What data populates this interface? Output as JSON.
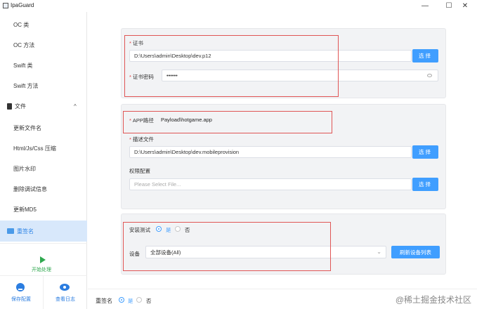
{
  "window": {
    "title": "IpaGuard",
    "min_glyph": "—",
    "max_glyph": "☐",
    "close_glyph": "✕"
  },
  "sidebar": {
    "items": [
      {
        "label": "OC 类"
      },
      {
        "label": "OC 方法"
      },
      {
        "label": "Swift 类"
      },
      {
        "label": "Swift 方法"
      }
    ],
    "section": {
      "label": "文件",
      "chevron": "^"
    },
    "file_items": [
      {
        "label": "更新文件名"
      },
      {
        "label": "Html/Js/Css 压缩"
      },
      {
        "label": "图片水印"
      },
      {
        "label": "删除调试信息"
      },
      {
        "label": "更新MD5"
      }
    ],
    "active_item": {
      "label": "重签名"
    },
    "run_label": "开始处理",
    "save_config": "保存配置",
    "view_log": "查看日志"
  },
  "cert_card": {
    "cert_label": "证书",
    "cert_path": "D:\\Users\\admin\\Desktop\\dev.p12",
    "cert_pwd_label": "证书密码",
    "cert_pwd_value": "••••••",
    "select_btn": "选择"
  },
  "profile_card": {
    "app_path_label": "APP路径",
    "app_path_value": "Payload\\hotgame.app",
    "desc_label": "描述文件",
    "desc_path": "D:\\Users\\admin\\Desktop\\dev.mobileprovision",
    "select_btn": "选择",
    "entitlements_label": "权限配置",
    "entitlements_placeholder": "Please Select File...",
    "select_btn2": "选择"
  },
  "install_card": {
    "install_label": "安装测试",
    "yes": "是",
    "no": "否",
    "install_selected": "是",
    "device_label": "设备",
    "device_value": "全部设备(All)",
    "refresh_btn": "刷新设备列表"
  },
  "footer": {
    "resign_label": "重签名",
    "yes": "是",
    "no": "否",
    "selected": "是"
  },
  "watermark": "@稀土掘金技术社区",
  "colors": {
    "accent": "#409eff",
    "highlight_box": "#e05555",
    "run_green": "#2fa84f"
  }
}
